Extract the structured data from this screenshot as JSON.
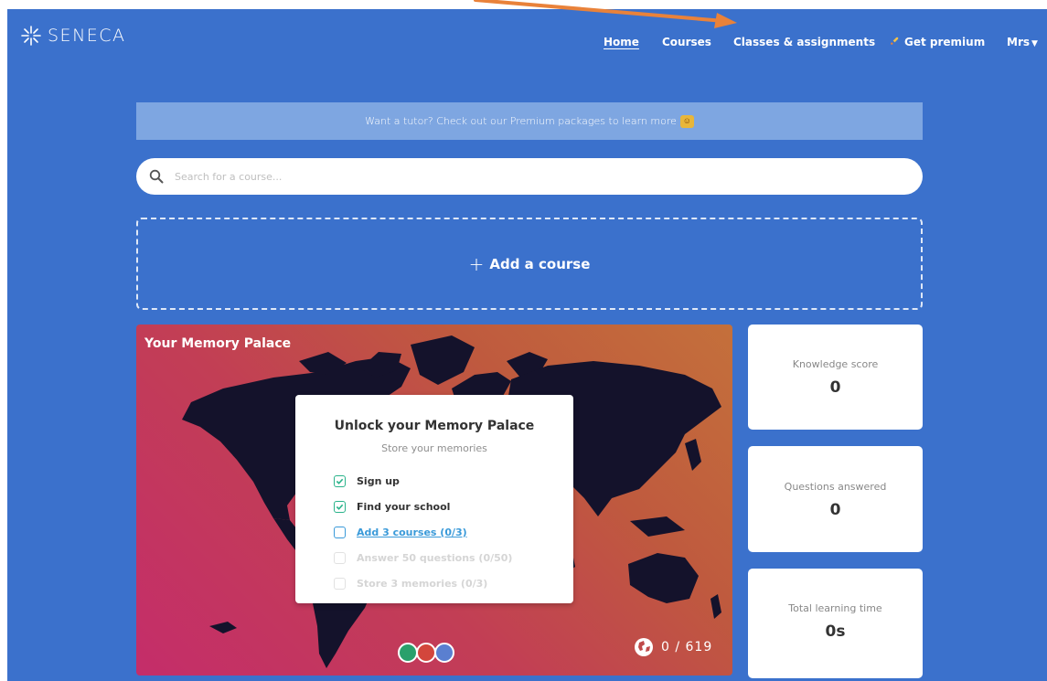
{
  "app": {
    "logo_text": "SENECA"
  },
  "nav": {
    "items": [
      {
        "label": "Home",
        "active": true
      },
      {
        "label": "Courses"
      },
      {
        "label": "Classes & assignments"
      },
      {
        "label": "Get premium",
        "icon": "rocket-icon"
      }
    ],
    "user_label": "Mrs"
  },
  "banner": {
    "text": "Want a tutor? Check out our Premium packages to learn more",
    "icon": "nerd-face-emoji"
  },
  "search": {
    "placeholder": "Search for a course..."
  },
  "add_course": {
    "label": "Add a course"
  },
  "memory_palace": {
    "title": "Your Memory Palace",
    "unlock_title": "Unlock your Memory Palace",
    "unlock_subtitle": "Store your memories",
    "checklist": [
      {
        "label": "Sign up",
        "status": "done"
      },
      {
        "label": "Find your school",
        "status": "done"
      },
      {
        "label": "Add 3 courses (0/3)",
        "status": "current"
      },
      {
        "label": "Answer 50 questions (0/50)",
        "status": "todo"
      },
      {
        "label": "Store 3 memories (0/3)",
        "status": "todo"
      }
    ],
    "dot_colors": [
      "#2aa06b",
      "#d3463c",
      "#5a7fd0"
    ],
    "counter": "0 / 619"
  },
  "stats": {
    "knowledge_label": "Knowledge score",
    "knowledge_value": "0",
    "questions_label": "Questions answered",
    "questions_value": "0",
    "time_label": "Total learning time",
    "time_value": "0s"
  },
  "colors": {
    "background": "#3b71cc",
    "banner": "#7ea6e1",
    "check_done": "#29b38a",
    "link": "#3a9ad9",
    "annotation_arrow": "#e9823a"
  }
}
